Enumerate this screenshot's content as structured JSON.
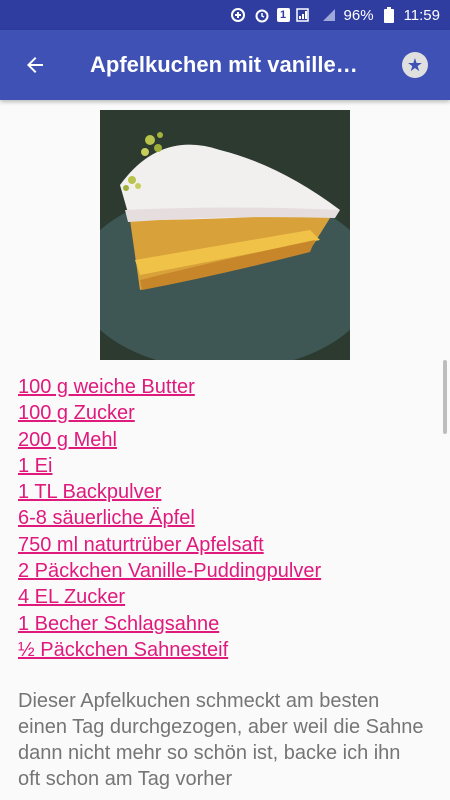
{
  "status_bar": {
    "notification_badge": "1",
    "battery_percent": "96%",
    "time": "11:59"
  },
  "app_bar": {
    "title": "Apfelkuchen mit vanille…"
  },
  "ingredients": [
    "100 g weiche Butter",
    "100 g Zucker",
    "200 g Mehl",
    "1 Ei",
    "1 TL Backpulver",
    "6-8 säuerliche Äpfel",
    "750 ml naturtrüber Apfelsaft",
    "2 Päckchen Vanille-Puddingpulver",
    "4 EL Zucker",
    "1 Becher Schlagsahne",
    "½ Päckchen Sahnesteif"
  ],
  "description": "Dieser Apfelkuchen schmeckt am besten einen Tag durchgezogen, aber weil die Sahne dann nicht mehr so schön ist, backe ich ihn oft schon am Tag vorher",
  "colors": {
    "status_bar": "#2f3da0",
    "app_bar": "#3f51b5",
    "link": "#e0197d",
    "body_text": "#757575"
  }
}
